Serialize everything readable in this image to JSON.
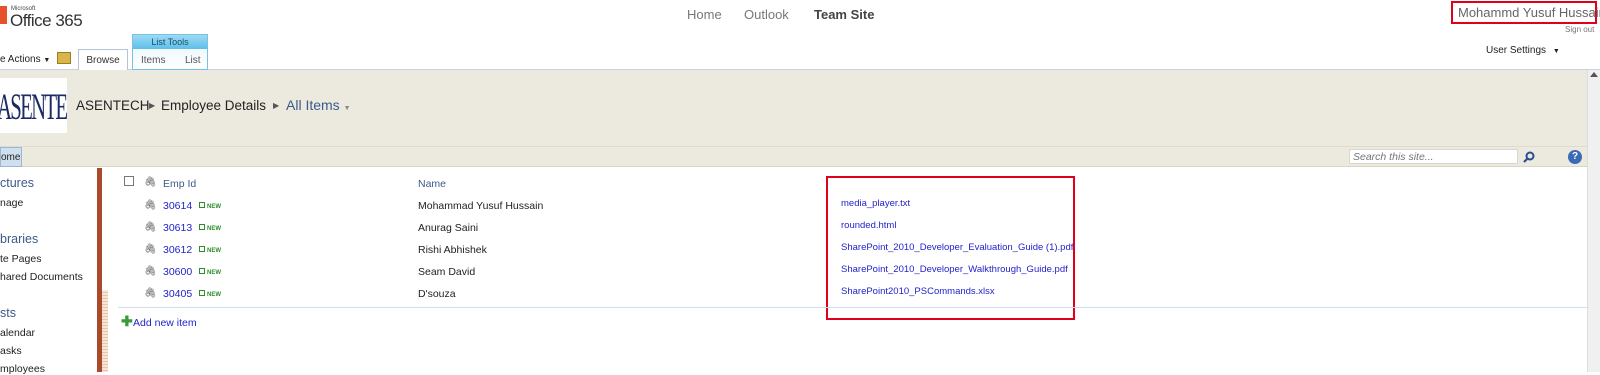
{
  "header": {
    "logo_brand": "Microsoft",
    "logo_product": "Office 365",
    "nav": [
      "Home",
      "Outlook",
      "Team Site"
    ],
    "user_name": "Mohammd Yusuf Hussain",
    "sign_out": "Sign out",
    "user_settings": "User Settings"
  },
  "ribbon": {
    "site_actions": "e Actions",
    "browse": "Browse",
    "list_tools": "List Tools",
    "items": "Items",
    "list": "List"
  },
  "title": {
    "logo_text": "ASENTECH",
    "site": "ASENTECH",
    "list": "Employee Details",
    "view": "All Items"
  },
  "linkbar": {
    "home": "ome",
    "search_placeholder": "Search this site...",
    "help": "?"
  },
  "quicklaunch": {
    "sections": [
      {
        "title": "ctures",
        "items": [
          "nage"
        ]
      },
      {
        "title": "braries",
        "items": [
          "te Pages",
          "hared Documents"
        ]
      },
      {
        "title": "sts",
        "items": [
          "alendar",
          "asks",
          "mployees"
        ]
      }
    ]
  },
  "list": {
    "headers": {
      "emp_id": "Emp Id",
      "name": "Name"
    },
    "new_label": "NEW",
    "rows": [
      {
        "emp_id": "30614",
        "name": "Mohammad Yusuf Hussain",
        "attachment": "media_player.txt"
      },
      {
        "emp_id": "30613",
        "name": "Anurag Saini",
        "attachment": "rounded.html"
      },
      {
        "emp_id": "30612",
        "name": "Rishi Abhishek",
        "attachment": "SharePoint_2010_Developer_Evaluation_Guide (1).pdf"
      },
      {
        "emp_id": "30600",
        "name": "Seam David",
        "attachment": "SharePoint_2010_Developer_Walkthrough_Guide.pdf"
      },
      {
        "emp_id": "30405",
        "name": "D'souza",
        "attachment": "SharePoint2010_PSCommands.xlsx"
      }
    ],
    "add_new": "Add new item"
  },
  "colors": {
    "accent_link": "#3b5a89",
    "highlight_box": "#e0001b",
    "title_bg": "#eceadf"
  }
}
